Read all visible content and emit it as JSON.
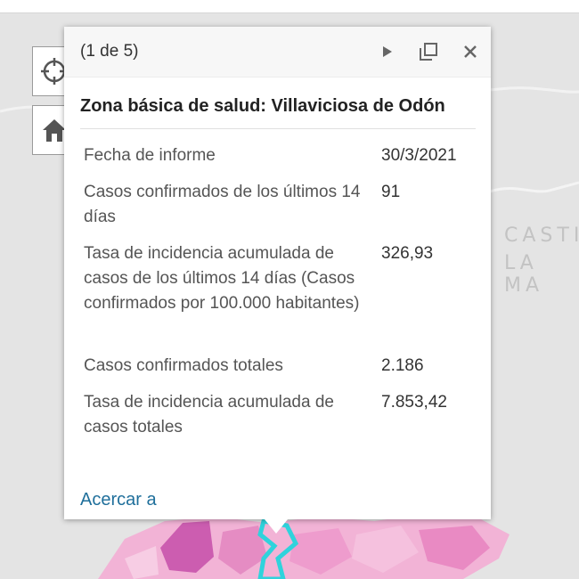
{
  "map": {
    "region_label_line1": "CASTI",
    "region_label_line2": "LA MA"
  },
  "popup": {
    "counter": "(1 de 5)",
    "title": "Zona básica de salud: Villaviciosa de Odón",
    "fields": [
      {
        "label": "Fecha de informe",
        "value": "30/3/2021"
      },
      {
        "label": "Casos confirmados de los últimos 14 días",
        "value": "91"
      },
      {
        "label": "Tasa de incidencia acumulada de casos de los últimos 14 días (Casos confirmados por 100.000 habitantes)",
        "value": "326,93"
      },
      {
        "label": "Casos confirmados totales",
        "value": "2.186"
      },
      {
        "label": "Tasa de incidencia acumulada de casos totales",
        "value": "7.853,42"
      }
    ],
    "zoom_link": "Acercar a"
  },
  "icons": {
    "next": "play-icon",
    "dock": "dock-icon",
    "close": "close-icon",
    "locate": "crosshair-icon",
    "home": "home-icon"
  },
  "colors": {
    "link": "#1f6f9b",
    "highlight": "#2fd3dc",
    "map_pink": "#f0a4cf"
  }
}
